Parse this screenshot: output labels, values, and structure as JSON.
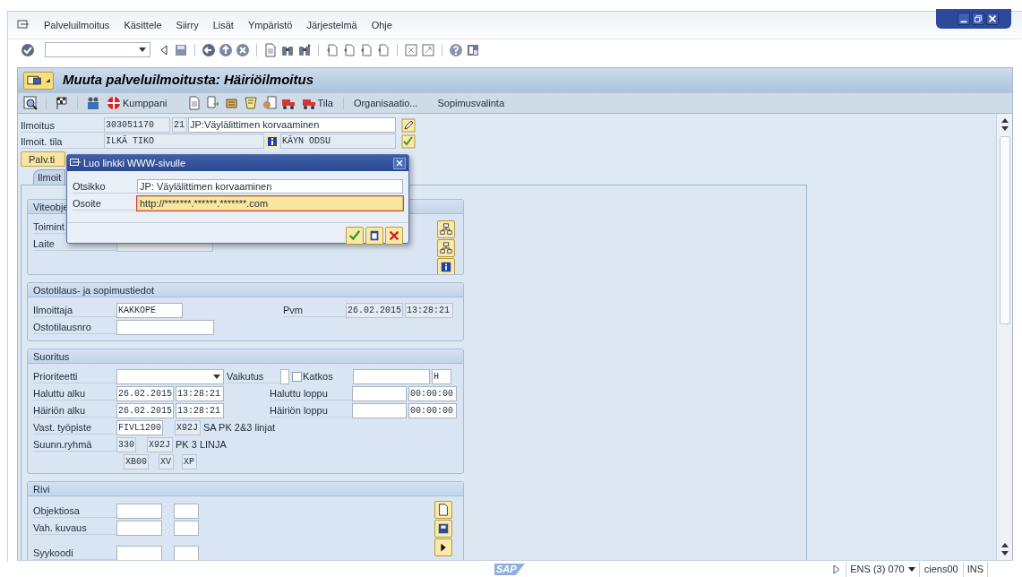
{
  "menu_bar": {
    "items": [
      "Palveluilmoitus",
      "Käsittele",
      "Siirry",
      "Lisät",
      "Ympäristö",
      "Järjestelmä",
      "Ohje"
    ]
  },
  "title": "Muuta palveluilmoitusta: Häiriöilmoitus",
  "app_toolbar": {
    "buttons": [
      {
        "label": "Kumppani"
      },
      {
        "label": "Tila"
      },
      {
        "label": "Organisaatio..."
      },
      {
        "label": "Sopimusvalinta"
      }
    ]
  },
  "header": {
    "notification": {
      "label": "Ilmoitus",
      "number": "303051170",
      "type": "21",
      "description": "JP:Väylälittimen korvaaminen"
    },
    "status": {
      "label": "Ilmoit. tila",
      "system_status": "ILKÄ TIKO",
      "user_status": "KÄYN ODSU"
    }
  },
  "service_button": "Palv.ti",
  "tabs": [
    {
      "label": "Ilmoit",
      "selected": true
    }
  ],
  "reference_object": {
    "title": "Viteobje",
    "rows": [
      "Toimint",
      "Laite"
    ]
  },
  "purchase": {
    "title": "Ostotilaus- ja sopimustiedot",
    "reporter": {
      "label": "Ilmoittaja",
      "value": "KAKKOPE"
    },
    "date": {
      "label": "Pvm",
      "date": "26.02.2015",
      "time": "13:28:21"
    },
    "po_number": {
      "label": "Ostotilausnro"
    }
  },
  "execution": {
    "title": "Suoritus",
    "priority": {
      "label": "Prioriteetti"
    },
    "effect": {
      "label": "Vaikutus"
    },
    "outage": {
      "label": "Katkos",
      "checked": false
    },
    "unit": "H",
    "required_start": {
      "label": "Haluttu alku",
      "date": "26.02.2015",
      "time": "13:28:21"
    },
    "required_end": {
      "label": "Haluttu loppu",
      "time": "00:00:00"
    },
    "fault_start": {
      "label": "Häiriön alku",
      "date": "26.02.2015",
      "time": "13:28:21"
    },
    "fault_end": {
      "label": "Häiriön loppu",
      "time": "00:00:00"
    },
    "work_center": {
      "label": "Vast. työpiste",
      "value": "FIVL1200",
      "plant": "X92J",
      "text": "SA PK 2&3 linjat"
    },
    "planner_group": {
      "label": "Suunn.ryhmä",
      "value": "330",
      "plant": "X92J",
      "text": "PK 3 LINJA"
    },
    "codes": [
      "XB00",
      "XV",
      "XP"
    ]
  },
  "item": {
    "title": "Rivi",
    "rows": [
      "Objektiosa",
      "Vah. kuvaus",
      "Syykoodi"
    ]
  },
  "dialog": {
    "title": "Luo linkki WWW-sivulle",
    "fields": [
      {
        "label": "Otsikko",
        "value": "JP: Väylälittimen korvaaminen",
        "focused": false
      },
      {
        "label": "Osoite",
        "value": "http://*******.******.*******.com",
        "focused": true
      }
    ]
  },
  "logo": "SAP",
  "status_bar": {
    "system": "ENS (3) 070",
    "user": "ciens00",
    "mode": "INS"
  }
}
